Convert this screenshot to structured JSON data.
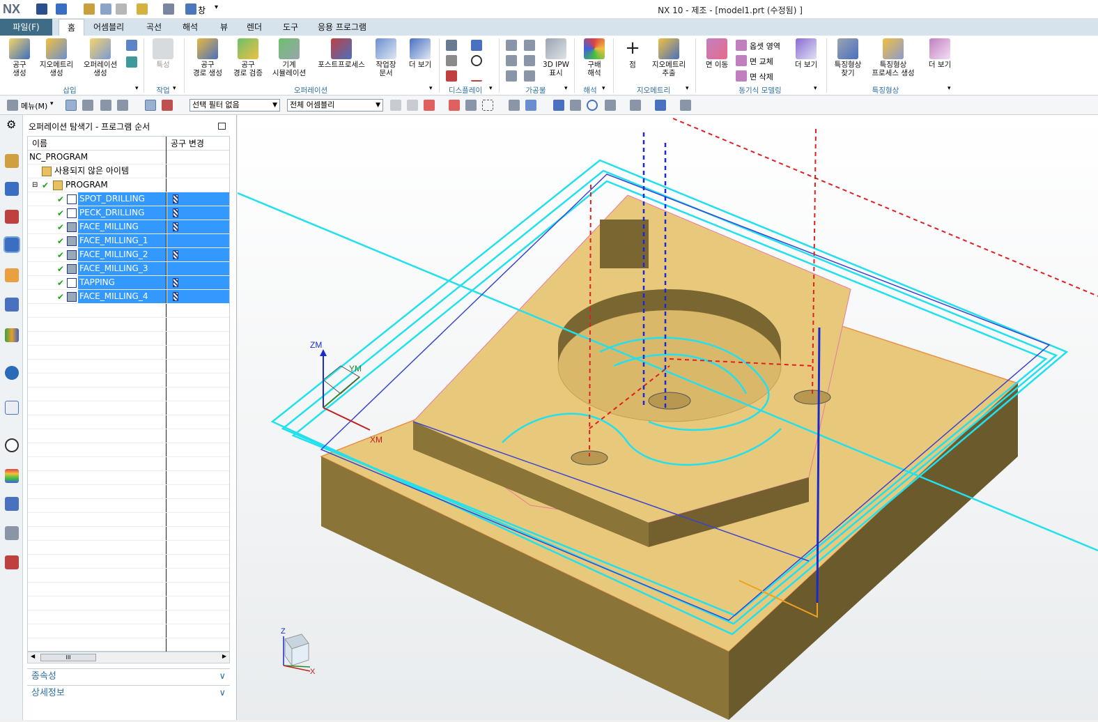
{
  "app": {
    "logo": "NX",
    "title": "NX 10 - 제조 - [model1.prt (수정됨) ]",
    "window_menu": "창"
  },
  "tabs": {
    "file": "파일(F)",
    "items": [
      "홈",
      "어셈블리",
      "곡선",
      "해석",
      "뷰",
      "렌더",
      "도구",
      "응용 프로그램"
    ],
    "active": "홈"
  },
  "ribbon": {
    "buttons": {
      "tool_create": "공구\n생성",
      "geometry_create": "지오메트리\n생성",
      "operation_create": "오퍼레이션\n생성",
      "properties": "특성",
      "toolpath_generate": "공구\n경로 생성",
      "toolpath_verify": "공구\n경로 검증",
      "machine_sim": "기계\n시뮬레이션",
      "postprocess": "포스트프로세스",
      "shop_doc": "작업장\n문서",
      "more1": "더 보기",
      "ipw": "3D IPW\n표시",
      "slope": "구배\n해석",
      "point": "점",
      "geom_extract": "지오메트리\n추출",
      "face_move": "면 이동",
      "offset_region": "옵셋 영역",
      "face_replace": "면 교체",
      "face_delete": "면 삭제",
      "more2": "더 보기",
      "feature_find": "특징형상\n찾기",
      "feature_process": "특징형상\n프로세스 생성",
      "more3": "더 보기"
    },
    "groups": {
      "insert": "삽입",
      "work": "작업",
      "operation": "오퍼레이션",
      "display": "디스플레이",
      "workpiece": "가공물",
      "analysis": "해석",
      "geometry": "지오메트리",
      "sync": "동기식 모델링",
      "feature": "특징형상"
    }
  },
  "cmdbar": {
    "menu": "메뉴(M)",
    "filter_select": "선택 필터 없음",
    "assembly_select": "전체 어셈블리"
  },
  "navigator": {
    "title": "오퍼레이션 탐색기 - 프로그램 순서",
    "columns": [
      "이름",
      "공구 변경"
    ],
    "root": "NC_PROGRAM",
    "unused": "사용되지 않은 아이템",
    "program": "PROGRAM",
    "operations": [
      {
        "name": "SPOT_DRILLING",
        "tool_change": true
      },
      {
        "name": "PECK_DRILLING",
        "tool_change": true
      },
      {
        "name": "FACE_MILLING",
        "tool_change": true
      },
      {
        "name": "FACE_MILLING_1",
        "tool_change": false
      },
      {
        "name": "FACE_MILLING_2",
        "tool_change": true
      },
      {
        "name": "FACE_MILLING_3",
        "tool_change": false
      },
      {
        "name": "TAPPING",
        "tool_change": true
      },
      {
        "name": "FACE_MILLING_4",
        "tool_change": true
      }
    ],
    "scroll_thumb": "III",
    "dependencies": "종속성",
    "details": "상세정보"
  },
  "viewport": {
    "axis_zm": "ZM",
    "axis_ym": "YM",
    "axis_xm": "XM",
    "triad_z": "Z",
    "triad_x": "X"
  },
  "colors": {
    "accent": "#3e6b86",
    "selection": "#3399ff",
    "part": "#e8c87a",
    "toolpath": "#22e0ee"
  }
}
